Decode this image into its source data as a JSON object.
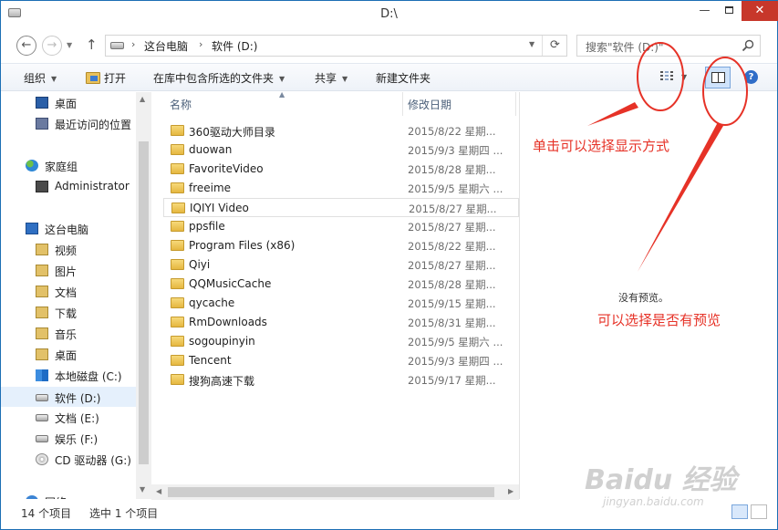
{
  "window": {
    "title": "D:\\",
    "close_glyph": "✕",
    "minimize_glyph": "—"
  },
  "address": {
    "crumbs": [
      "这台电脑",
      "软件 (D:)"
    ],
    "separator": "›",
    "search_placeholder": "搜索\"软件 (D:)\""
  },
  "toolbar": {
    "organize": "组织",
    "open": "打开",
    "include_library": "在库中包含所选的文件夹",
    "share": "共享",
    "new_folder": "新建文件夹",
    "help": "?"
  },
  "nav": {
    "items": [
      {
        "label": "桌面",
        "icon": "desktop-icon"
      },
      {
        "label": "最近访问的位置",
        "icon": "recent-places-icon"
      },
      {
        "label": "家庭组",
        "icon": "homegroup-icon"
      },
      {
        "label": "Administrator",
        "icon": "user-icon"
      },
      {
        "label": "这台电脑",
        "icon": "computer-icon"
      },
      {
        "label": "视频",
        "icon": "videos-icon"
      },
      {
        "label": "图片",
        "icon": "pictures-icon"
      },
      {
        "label": "文档",
        "icon": "documents-icon"
      },
      {
        "label": "下载",
        "icon": "downloads-icon"
      },
      {
        "label": "音乐",
        "icon": "music-icon"
      },
      {
        "label": "桌面",
        "icon": "desktop-folder-icon"
      },
      {
        "label": "本地磁盘 (C:)",
        "icon": "windows-drive-icon"
      },
      {
        "label": "软件 (D:)",
        "icon": "drive-icon",
        "selected": true
      },
      {
        "label": "文档 (E:)",
        "icon": "drive-icon"
      },
      {
        "label": "娱乐 (F:)",
        "icon": "drive-icon"
      },
      {
        "label": "CD 驱动器 (G:)",
        "icon": "cd-drive-icon"
      },
      {
        "label": "网络",
        "icon": "network-icon"
      }
    ]
  },
  "files": {
    "columns": {
      "name": "名称",
      "date": "修改日期"
    },
    "rows": [
      {
        "name": "360驱动大师目录",
        "date": "2015/8/22 星期..."
      },
      {
        "name": "duowan",
        "date": "2015/9/3 星期四 ..."
      },
      {
        "name": "FavoriteVideo",
        "date": "2015/8/28 星期..."
      },
      {
        "name": "freeime",
        "date": "2015/9/5 星期六 ..."
      },
      {
        "name": "IQIYI Video",
        "date": "2015/8/27 星期..."
      },
      {
        "name": "ppsfile",
        "date": "2015/8/27 星期..."
      },
      {
        "name": "Program Files (x86)",
        "date": "2015/8/22 星期..."
      },
      {
        "name": "Qiyi",
        "date": "2015/8/27 星期..."
      },
      {
        "name": "QQMusicCache",
        "date": "2015/8/28 星期..."
      },
      {
        "name": "qycache",
        "date": "2015/9/15 星期..."
      },
      {
        "name": "RmDownloads",
        "date": "2015/8/31 星期..."
      },
      {
        "name": "sogoupinyin",
        "date": "2015/9/5 星期六 ..."
      },
      {
        "name": "Tencent",
        "date": "2015/9/3 星期四 ..."
      },
      {
        "name": "搜狗高速下载",
        "date": "2015/9/17 星期..."
      }
    ]
  },
  "preview": {
    "empty_text": "没有预览。"
  },
  "annotations": {
    "view_mode": "单击可以选择显示方式",
    "preview_toggle": "可以选择是否有预览",
    "color": "#e63227"
  },
  "status": {
    "count": "14 个项目",
    "selected": "选中 1 个项目"
  },
  "watermark": {
    "brand": "Baidu 经验",
    "url": "jingyan.baidu.com"
  }
}
